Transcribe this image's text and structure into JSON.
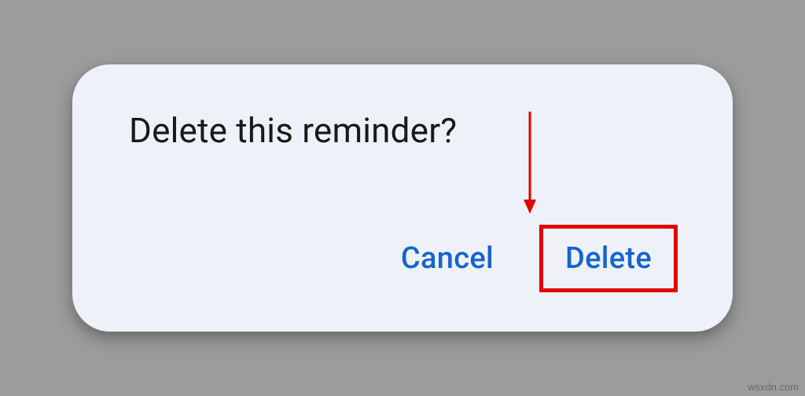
{
  "dialog": {
    "title": "Delete this reminder?",
    "cancel_label": "Cancel",
    "delete_label": "Delete"
  },
  "annotation": {
    "arrow_color": "#e30000",
    "highlight_color": "#e30000"
  },
  "watermark": "wsxdn.com"
}
